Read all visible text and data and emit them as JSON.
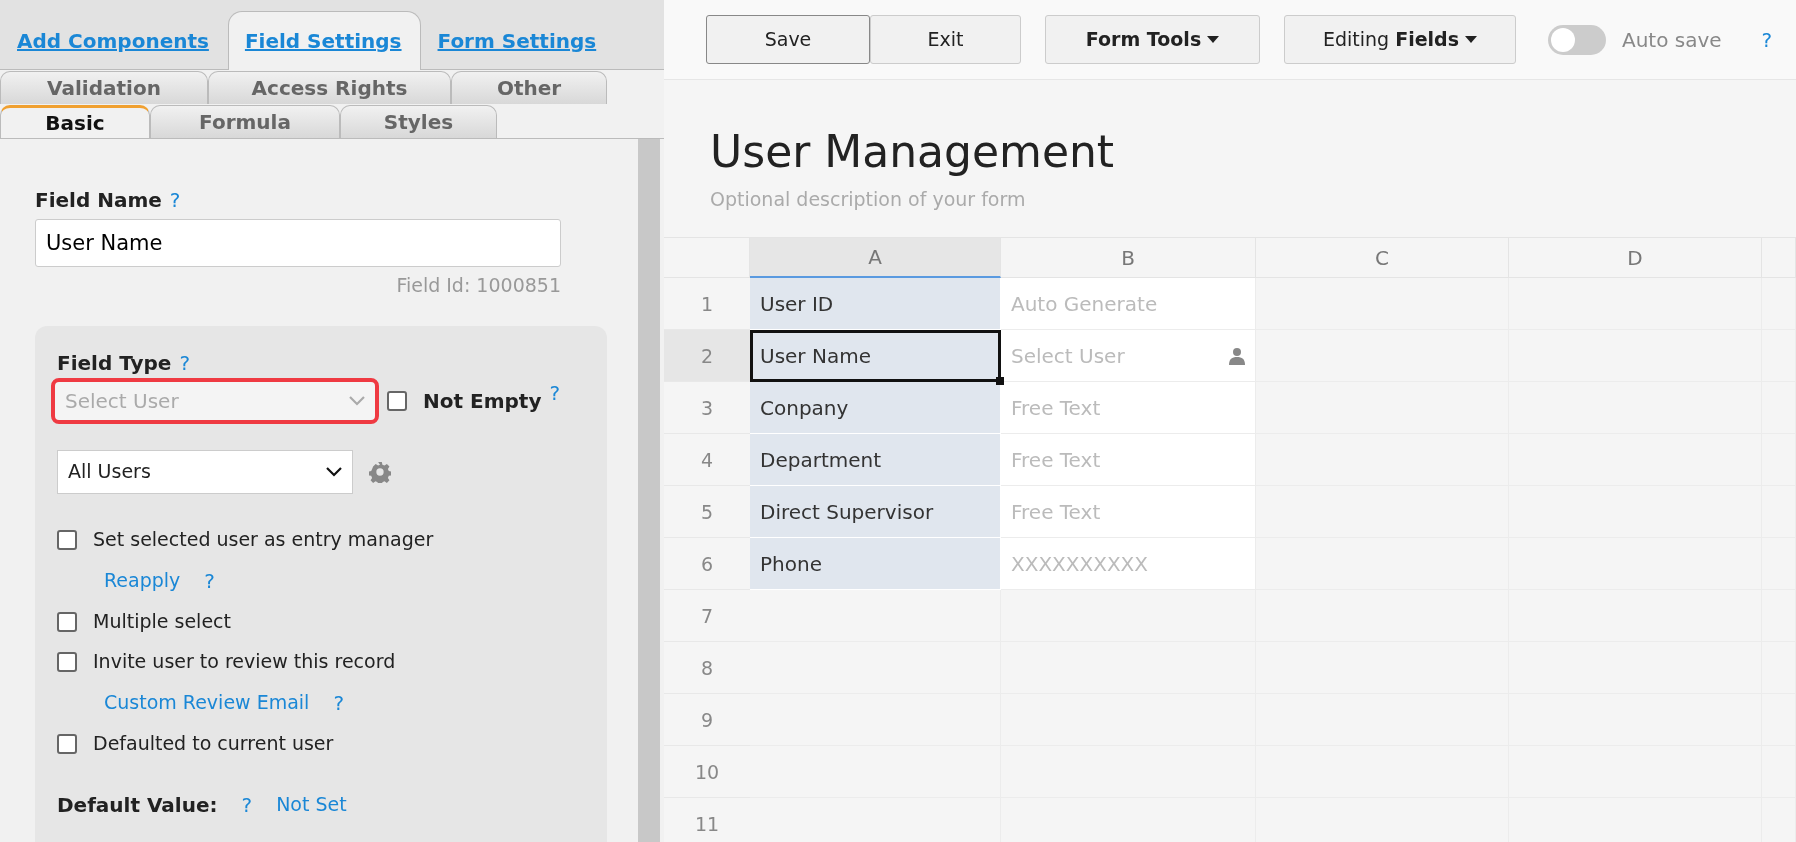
{
  "main_tabs": [
    {
      "label": "Add Components",
      "selected": false
    },
    {
      "label": "Field Settings",
      "selected": true
    },
    {
      "label": "Form Settings",
      "selected": false
    }
  ],
  "sub_tab_rows": [
    {
      "tabs": [
        {
          "label": "Validation",
          "selected": false
        },
        {
          "label": "Access Rights",
          "selected": false
        },
        {
          "label": "Other",
          "selected": false
        }
      ]
    },
    {
      "tabs": [
        {
          "label": "Basic",
          "selected": true
        },
        {
          "label": "Formula",
          "selected": false
        },
        {
          "label": "Styles",
          "selected": false
        }
      ]
    }
  ],
  "field_name": {
    "label": "Field Name",
    "help": "?",
    "value": "User Name",
    "field_id": "Field Id: 1000851"
  },
  "field_type": {
    "label": "Field Type",
    "help": "?",
    "value": "Select User",
    "highlighted": true,
    "not_empty": {
      "label": "Not Empty",
      "checked": false,
      "help": "?"
    }
  },
  "user_scope": {
    "value": "All Users"
  },
  "options": [
    {
      "kind": "checkbox",
      "label": "Set selected user as entry manager",
      "checked": false
    },
    {
      "kind": "link",
      "label": "Reapply",
      "help": "?"
    },
    {
      "kind": "checkbox",
      "label": "Multiple select",
      "checked": false
    },
    {
      "kind": "checkbox",
      "label": "Invite user to review this record",
      "checked": false
    },
    {
      "kind": "link",
      "label": "Custom Review Email",
      "help": "?"
    },
    {
      "kind": "checkbox",
      "label": "Defaulted to current user",
      "checked": false
    }
  ],
  "default_value": {
    "label": "Default Value:",
    "help": "?",
    "value": "Not Set"
  },
  "toolbar": {
    "buttons": [
      {
        "label": "Save",
        "kind": "plain"
      },
      {
        "label": "Exit",
        "kind": "plain"
      },
      {
        "label": "Form Tools",
        "kind": "dropdown"
      },
      {
        "label": "Editing **Fields**",
        "kind": "dropdown"
      }
    ],
    "auto_save": {
      "label": "Auto save",
      "on": false,
      "help": "?"
    }
  },
  "form": {
    "title": "User Management",
    "description": "Optional description of your form"
  },
  "grid": {
    "columns": [
      {
        "label": "A",
        "selected": true
      },
      {
        "label": "B",
        "selected": false
      },
      {
        "label": "C",
        "selected": false
      },
      {
        "label": "D",
        "selected": false
      }
    ],
    "rows": [
      {
        "number": "1",
        "selected": false,
        "cells": [
          {
            "text": "User ID",
            "kind": "label"
          },
          {
            "text": "Auto Generate",
            "kind": "hint"
          }
        ]
      },
      {
        "number": "2",
        "selected": true,
        "cells": [
          {
            "text": "User Name",
            "kind": "label"
          },
          {
            "text": "Select User",
            "kind": "user"
          }
        ]
      },
      {
        "number": "3",
        "selected": false,
        "cells": [
          {
            "text": "Conpany",
            "kind": "label"
          },
          {
            "text": "Free Text",
            "kind": "hint"
          }
        ]
      },
      {
        "number": "4",
        "selected": false,
        "cells": [
          {
            "text": "Department",
            "kind": "label"
          },
          {
            "text": "Free Text",
            "kind": "hint"
          }
        ]
      },
      {
        "number": "5",
        "selected": false,
        "cells": [
          {
            "text": "Direct Supervisor",
            "kind": "label"
          },
          {
            "text": "Free Text",
            "kind": "hint"
          }
        ]
      },
      {
        "number": "6",
        "selected": false,
        "cells": [
          {
            "text": "Phone",
            "kind": "label"
          },
          {
            "text": "XXXXXXXXXX",
            "kind": "hint"
          }
        ]
      },
      {
        "number": "7",
        "selected": false,
        "cells": []
      },
      {
        "number": "8",
        "selected": false,
        "cells": []
      },
      {
        "number": "9",
        "selected": false,
        "cells": []
      },
      {
        "number": "10",
        "selected": false,
        "cells": []
      },
      {
        "number": "11",
        "selected": false,
        "cells": []
      }
    ]
  }
}
